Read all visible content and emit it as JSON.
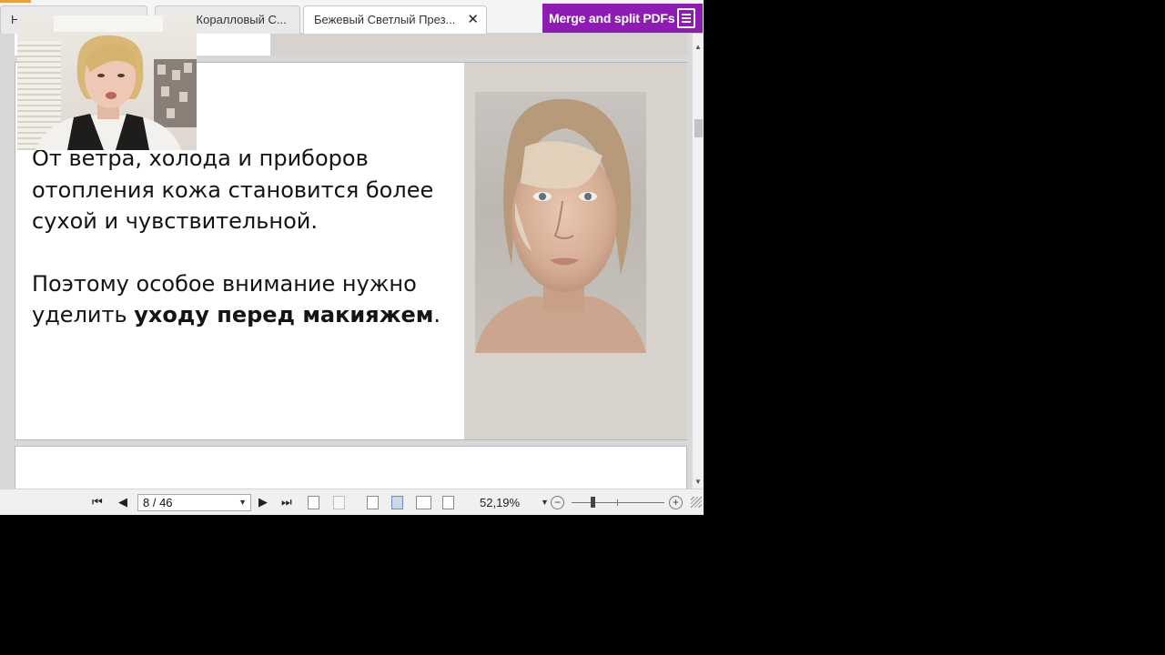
{
  "tabs": [
    {
      "label": "Н"
    },
    {
      "label": "о-Коралловый С..."
    },
    {
      "label": "Бежевый Светлый През...",
      "close": "✕"
    }
  ],
  "promo": {
    "label": "Merge and split PDFs",
    "bg": "#8e1cb3"
  },
  "slide": {
    "paragraph1": "От ветра, холода и приборов отопления кожа становится более сухой и чувствительной.",
    "paragraph2_plain": "Поэтому особое внимание нужно уделить ",
    "paragraph2_bold": "уходу перед макияжем",
    "paragraph2_end": ".",
    "panel_color": "#d9d3cd"
  },
  "toolbar": {
    "page_indicator": "8 / 46",
    "zoom": "52,19%",
    "zoom_level_fraction": 0.23
  }
}
